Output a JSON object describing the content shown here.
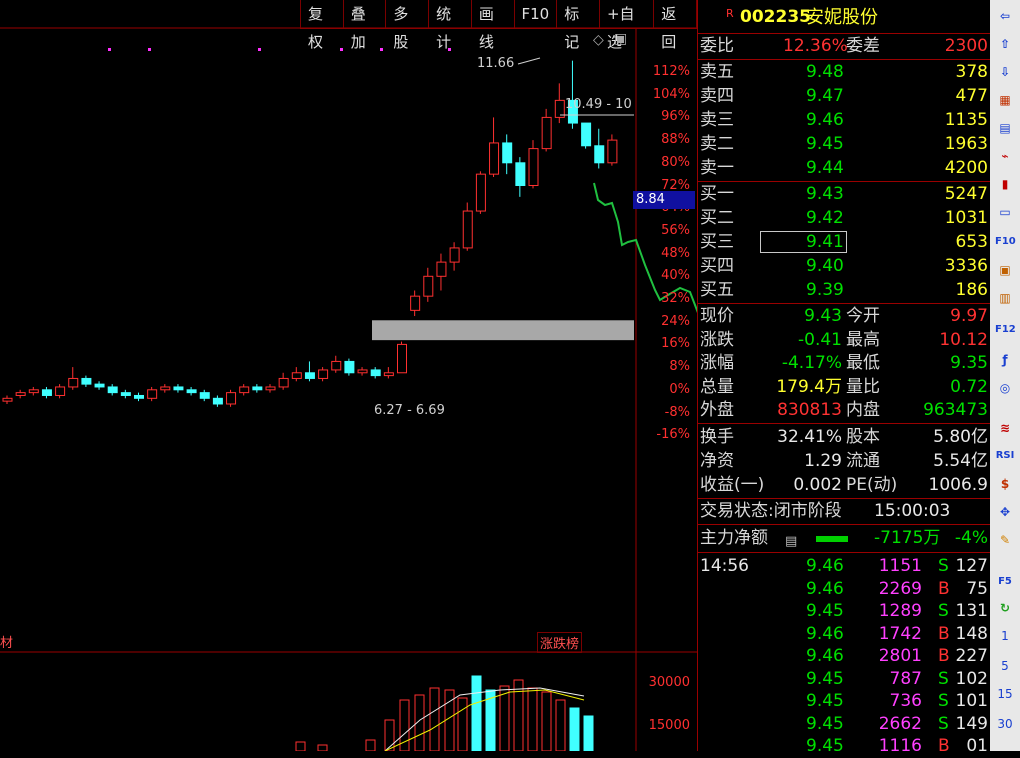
{
  "toolbar": [
    "复权",
    "叠加",
    "多股",
    "统计",
    "画线",
    "F10",
    "标记",
    "+自选",
    "返回"
  ],
  "chart": {
    "axis_labels": [
      "112%",
      "104%",
      "96%",
      "88%",
      "80%",
      "72%",
      "64%",
      "56%",
      "48%",
      "40%",
      "32%",
      "24%",
      "16%",
      "8%",
      "0%",
      "-8%",
      "-16%"
    ],
    "price_tag": "8.84",
    "high_annotation": "11.66",
    "right_annotation": "10.49 - 10",
    "gap_annotation": "6.27 - 6.69",
    "rank_label": "涨跌榜",
    "left_mark": "材",
    "volume_labels": [
      "30000",
      "15000"
    ]
  },
  "chart_data": {
    "type": "candlestick",
    "y_unit": "percent",
    "ylim": [
      -16,
      112
    ],
    "candles": [
      [
        -4,
        -3,
        -5,
        -2
      ],
      [
        -2,
        -1,
        -3,
        0
      ],
      [
        -1,
        0,
        -2,
        1
      ],
      [
        0,
        -2,
        -3,
        1
      ],
      [
        -2,
        1,
        -3,
        2
      ],
      [
        1,
        4,
        0,
        8
      ],
      [
        4,
        2,
        1,
        5
      ],
      [
        2,
        1,
        0,
        3
      ],
      [
        1,
        -1,
        -2,
        2
      ],
      [
        -1,
        -2,
        -3,
        0
      ],
      [
        -2,
        -3,
        -4,
        -1
      ],
      [
        -3,
        0,
        -4,
        1
      ],
      [
        0,
        1,
        -1,
        2
      ],
      [
        1,
        0,
        -1,
        2
      ],
      [
        0,
        -1,
        -2,
        1
      ],
      [
        -1,
        -3,
        -4,
        0
      ],
      [
        -3,
        -5,
        -6,
        -2
      ],
      [
        -5,
        -1,
        -6,
        0
      ],
      [
        -1,
        1,
        -2,
        2
      ],
      [
        1,
        0,
        -1,
        2
      ],
      [
        0,
        1,
        -1,
        2
      ],
      [
        1,
        4,
        0,
        6
      ],
      [
        4,
        6,
        3,
        8
      ],
      [
        6,
        4,
        3,
        10
      ],
      [
        4,
        7,
        3,
        8
      ],
      [
        7,
        10,
        6,
        12
      ],
      [
        10,
        6,
        5,
        11
      ],
      [
        6,
        7,
        5,
        8
      ],
      [
        7,
        5,
        4,
        8
      ],
      [
        5,
        6,
        4,
        8
      ],
      [
        6,
        16,
        6,
        17
      ],
      [
        28,
        33,
        26,
        35
      ],
      [
        33,
        40,
        31,
        43
      ],
      [
        40,
        45,
        35,
        48
      ],
      [
        45,
        50,
        42,
        52
      ],
      [
        50,
        63,
        49,
        66
      ],
      [
        63,
        76,
        62,
        77
      ],
      [
        76,
        87,
        75,
        96
      ],
      [
        87,
        80,
        76,
        90
      ],
      [
        80,
        72,
        68,
        82
      ],
      [
        72,
        85,
        71,
        88
      ],
      [
        85,
        96,
        84,
        99
      ],
      [
        96,
        102,
        94,
        108
      ],
      [
        102,
        94,
        92,
        116
      ],
      [
        94,
        86,
        85,
        92
      ],
      [
        86,
        80,
        78,
        92
      ],
      [
        80,
        88,
        79,
        90
      ]
    ],
    "high": 11.66,
    "intraday_line": "green",
    "gap_range": [
      6.27,
      6.69
    ]
  },
  "quote": {
    "code": "002235",
    "name": "安妮股份",
    "rflag": "R",
    "weibi_label": "委比",
    "weibi": "12.36%",
    "weicha_label": "委差",
    "weicha": "2300",
    "sell": [
      {
        "label": "卖五",
        "price": "9.48",
        "vol": "378"
      },
      {
        "label": "卖四",
        "price": "9.47",
        "vol": "477"
      },
      {
        "label": "卖三",
        "price": "9.46",
        "vol": "1135"
      },
      {
        "label": "卖二",
        "price": "9.45",
        "vol": "1963"
      },
      {
        "label": "卖一",
        "price": "9.44",
        "vol": "4200"
      }
    ],
    "buy": [
      {
        "label": "买一",
        "price": "9.43",
        "vol": "5247"
      },
      {
        "label": "买二",
        "price": "9.42",
        "vol": "1031"
      },
      {
        "label": "买三",
        "price": "9.41",
        "vol": "653"
      },
      {
        "label": "买四",
        "price": "9.40",
        "vol": "3336"
      },
      {
        "label": "买五",
        "price": "9.39",
        "vol": "186"
      }
    ],
    "stats": [
      {
        "l1": "现价",
        "v1": "9.43",
        "c1": "green",
        "l2": "今开",
        "v2": "9.97",
        "c2": "red"
      },
      {
        "l1": "涨跌",
        "v1": "-0.41",
        "c1": "green",
        "l2": "最高",
        "v2": "10.12",
        "c2": "red"
      },
      {
        "l1": "涨幅",
        "v1": "-4.17%",
        "c1": "green",
        "l2": "最低",
        "v2": "9.35",
        "c2": "green"
      },
      {
        "l1": "总量",
        "v1": "179.4万",
        "c1": "yellow",
        "l2": "量比",
        "v2": "0.72",
        "c2": "green"
      },
      {
        "l1": "外盘",
        "v1": "830813",
        "c1": "red",
        "l2": "内盘",
        "v2": "963473",
        "c2": "green"
      }
    ],
    "fund": [
      {
        "l1": "换手",
        "v1": "32.41%",
        "l2": "股本",
        "v2": "5.80亿"
      },
      {
        "l1": "净资",
        "v1": "1.29",
        "l2": "流通",
        "v2": "5.54亿"
      },
      {
        "l1": "收益(一)",
        "v1": "0.002",
        "l2": "PE(动)",
        "v2": "1006.9"
      }
    ],
    "status_label": "交易状态:闭市阶段",
    "status_time": "15:00:03",
    "main_flow_label": "主力净额",
    "main_flow_value": "-7175万",
    "main_flow_pct": "-4%",
    "ticks": [
      {
        "time": "14:56",
        "price": "9.46",
        "vol": "1151",
        "bs": "S",
        "n": "127"
      },
      {
        "time": "",
        "price": "9.46",
        "vol": "2269",
        "bs": "B",
        "n": "75"
      },
      {
        "time": "",
        "price": "9.45",
        "vol": "1289",
        "bs": "S",
        "n": "131"
      },
      {
        "time": "",
        "price": "9.46",
        "vol": "1742",
        "bs": "B",
        "n": "148"
      },
      {
        "time": "",
        "price": "9.46",
        "vol": "2801",
        "bs": "B",
        "n": "227"
      },
      {
        "time": "",
        "price": "9.45",
        "vol": "787",
        "bs": "S",
        "n": "102"
      },
      {
        "time": "",
        "price": "9.45",
        "vol": "736",
        "bs": "S",
        "n": "101"
      },
      {
        "time": "",
        "price": "9.45",
        "vol": "2662",
        "bs": "S",
        "n": "149"
      },
      {
        "time": "",
        "price": "9.45",
        "vol": "1116",
        "bs": "B",
        "n": "01"
      }
    ]
  },
  "sidebar": {
    "labels": [
      "F10",
      "F12",
      "RSI",
      "F5",
      "1",
      "5",
      "15",
      "30"
    ]
  }
}
